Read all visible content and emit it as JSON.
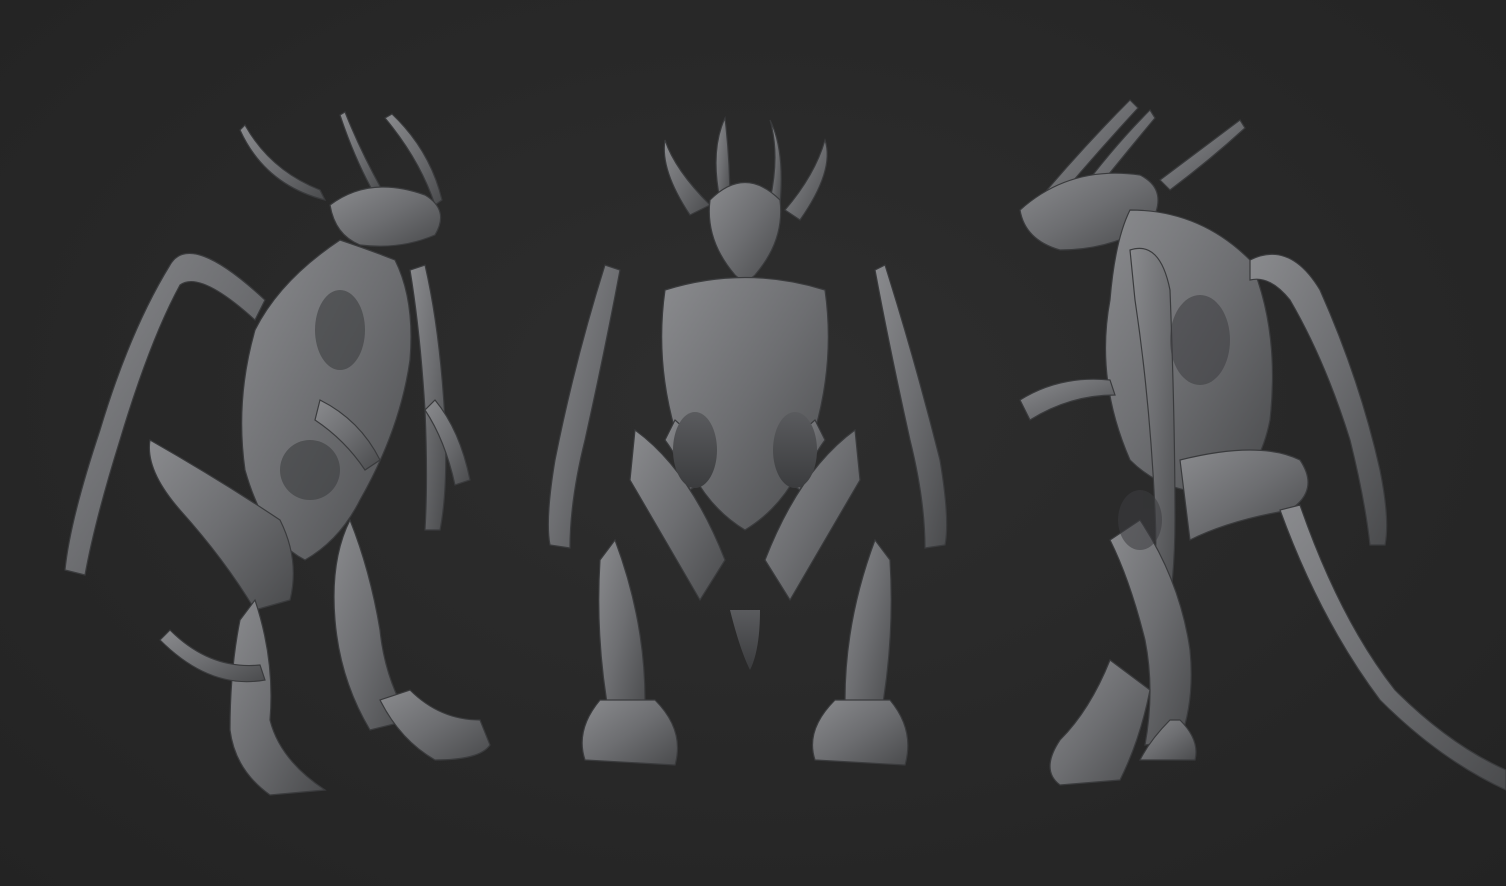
{
  "scene": {
    "background": "#282828",
    "material_color": "#6f7073",
    "material_shadow": "#3e3f41",
    "material_highlight": "#8e8f92",
    "views": [
      {
        "id": "three-quarter",
        "icon": "creature-three-quarter-view"
      },
      {
        "id": "front",
        "icon": "creature-front-view"
      },
      {
        "id": "side",
        "icon": "creature-side-view"
      }
    ]
  }
}
